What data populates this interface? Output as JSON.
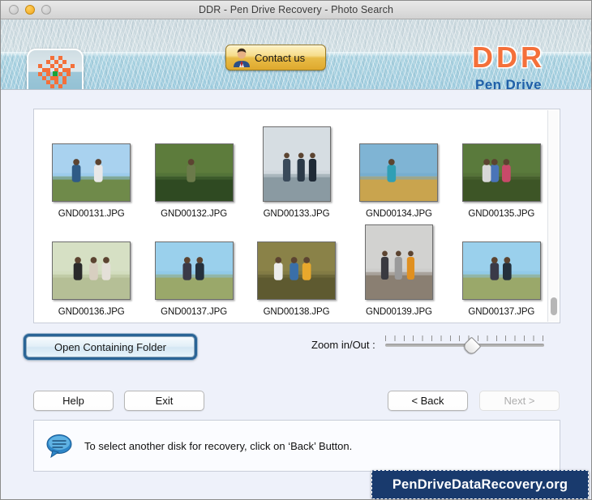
{
  "window": {
    "title": "DDR - Pen Drive Recovery - Photo Search",
    "traffic_lights": [
      "close",
      "minimize",
      "zoom"
    ]
  },
  "header": {
    "app_icon_name": "ddr-app-icon",
    "contact_button": "Contact us",
    "brand_primary": "DDR",
    "brand_secondary": "Pen Drive",
    "brand_primary_color": "#f4703a",
    "brand_secondary_color": "#1f5fa8"
  },
  "thumbnails": {
    "rows": [
      [
        {
          "name": "GND00131.JPG",
          "shape": "land",
          "selected": false
        },
        {
          "name": "GND00132.JPG",
          "shape": "land",
          "selected": false
        },
        {
          "name": "GND00133.JPG",
          "shape": "sq",
          "selected": true
        },
        {
          "name": "GND00134.JPG",
          "shape": "land",
          "selected": false
        },
        {
          "name": "GND00135.JPG",
          "shape": "land",
          "selected": false
        }
      ],
      [
        {
          "name": "GND00136.JPG",
          "shape": "land",
          "selected": false
        },
        {
          "name": "GND00137.JPG",
          "shape": "land",
          "selected": false
        },
        {
          "name": "GND00138.JPG",
          "shape": "land",
          "selected": false
        },
        {
          "name": "GND00139.JPG",
          "shape": "sq",
          "selected": true
        },
        {
          "name": "GND00137.JPG",
          "shape": "land",
          "selected": false
        }
      ]
    ]
  },
  "controls": {
    "open_containing_folder": "Open Containing Folder",
    "zoom_label": "Zoom in/Out :",
    "zoom_value": 50,
    "zoom_min": 0,
    "zoom_max": 100,
    "help": "Help",
    "exit": "Exit",
    "back": "< Back",
    "next": "Next >",
    "next_enabled": false
  },
  "status": {
    "icon_name": "speech-bubble-icon",
    "message": "To select another disk for recovery, click on ‘Back’ Button."
  },
  "watermark": {
    "text": "PenDriveDataRecovery.org",
    "background_color": "#193a6d"
  }
}
